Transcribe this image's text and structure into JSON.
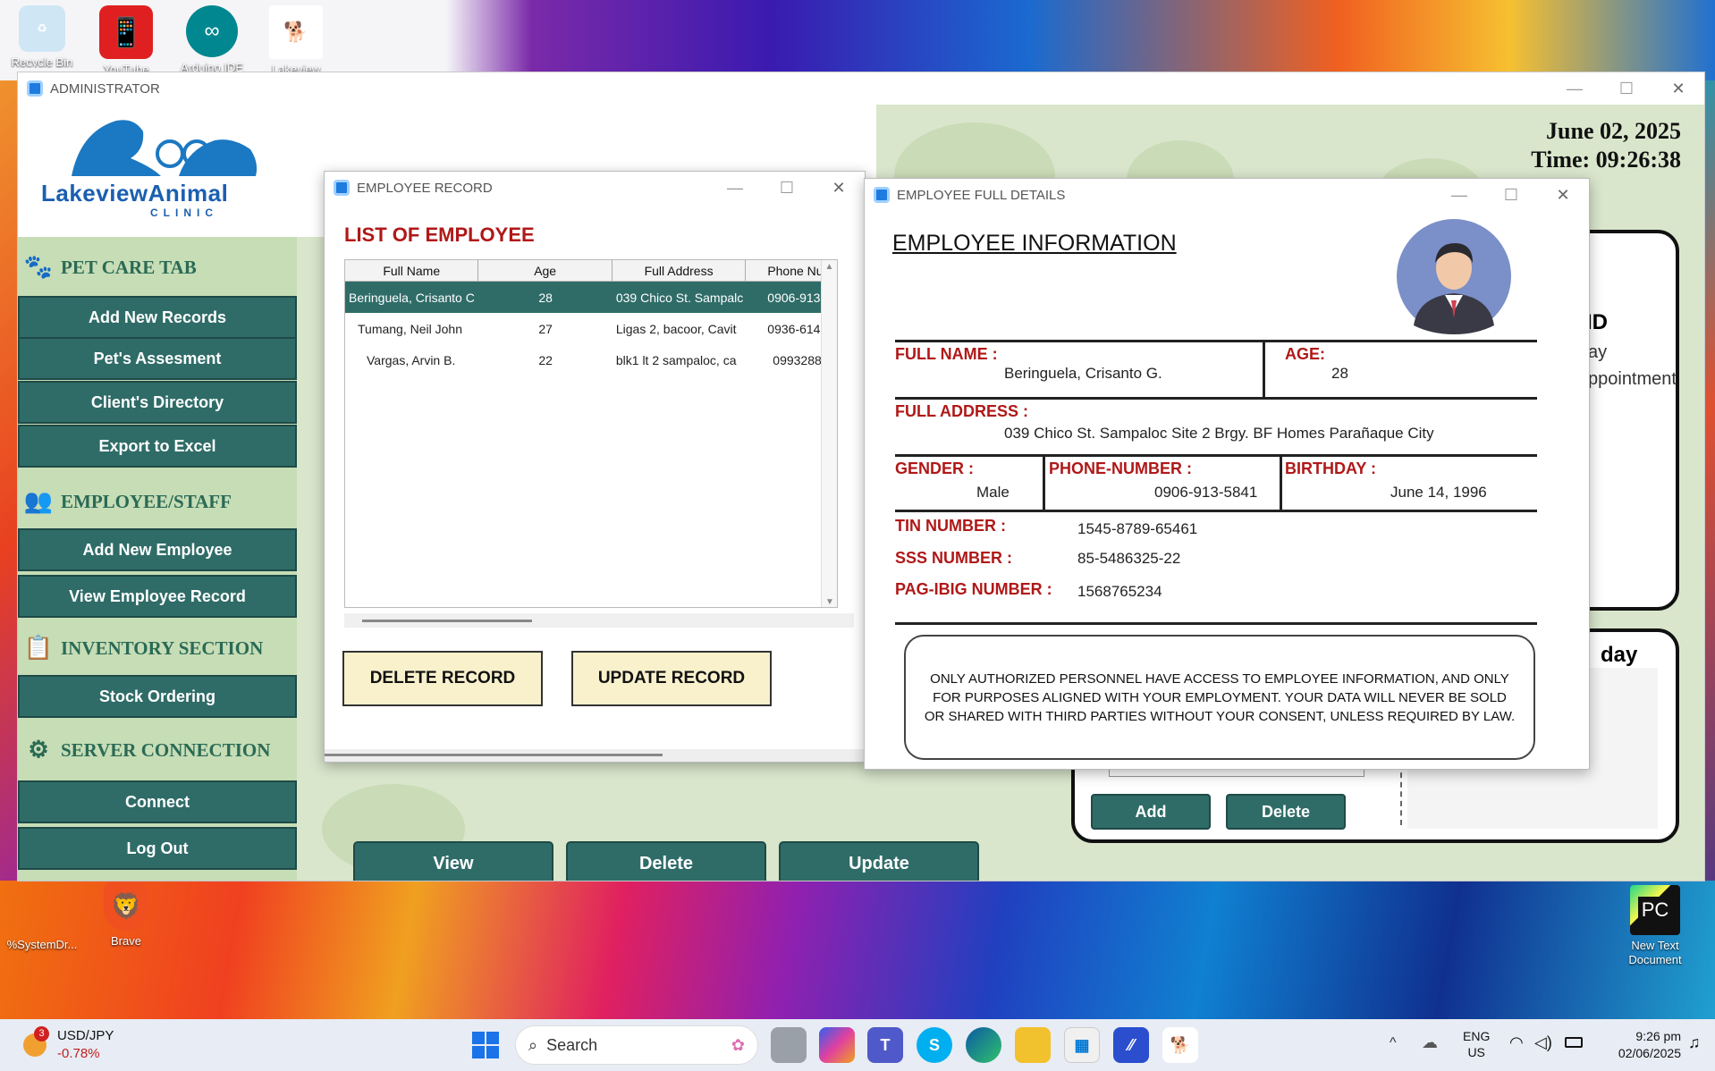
{
  "desktop": {
    "icons": [
      {
        "label": "Recycle Bin",
        "icon": "recycle-bin-icon"
      },
      {
        "label": "YouTube",
        "icon": "phone-icon"
      },
      {
        "label": "Arduino IDE",
        "icon": "arduino-icon"
      },
      {
        "label": "Lakeview",
        "icon": "lakeview-icon"
      },
      {
        "label": "%SystemDr...",
        "icon": "folder-icon"
      },
      {
        "label": "Brave",
        "icon": "brave-icon"
      },
      {
        "label": "New Text Document",
        "icon": "pycharm-icon"
      }
    ]
  },
  "main_window": {
    "title": "ADMINISTRATOR",
    "date": "June 02, 2025",
    "time": "Time:  09:26:38",
    "logo_text": "LakeviewAnimal",
    "logo_sub": "CLINIC",
    "sidebar": {
      "pet_care_title": "PET CARE TAB",
      "pet_care_buttons": [
        "Add New Records",
        "Pet's Assesment",
        "Client's Directory",
        "Export to Excel"
      ],
      "employee_title": "EMPLOYEE/STAFF",
      "employee_buttons": [
        "Add New Employee",
        "View Employee Record"
      ],
      "inventory_title": "INVENTORY SECTION",
      "inventory_buttons": [
        "Stock Ordering"
      ],
      "server_title": "SERVER CONNECTION",
      "server_buttons": [
        "Connect",
        "Log Out"
      ]
    },
    "bottom_buttons": [
      "View",
      "Delete",
      "Update"
    ],
    "right_panel_fragments": [
      "ID",
      "ay",
      "ppointment",
      "day"
    ],
    "right_buttons": [
      "Add",
      "Delete"
    ]
  },
  "record_window": {
    "title": "EMPLOYEE RECORD",
    "heading": "LIST OF EMPLOYEE",
    "columns": [
      "Full Name",
      "Age",
      "Full Address",
      "Phone Nur"
    ],
    "rows": [
      {
        "name": "Beringuela, Crisanto C",
        "age": "28",
        "address": "039 Chico St. Sampalc",
        "phone": "0906-913-"
      },
      {
        "name": "Tumang, Neil John",
        "age": "27",
        "address": "Ligas 2, bacoor, Cavit",
        "phone": "0936-614-"
      },
      {
        "name": "Vargas, Arvin B.",
        "age": "22",
        "address": "blk1 lt 2 sampaloc, ca",
        "phone": "09932882"
      }
    ],
    "delete_button": "DELETE RECORD",
    "update_button": "UPDATE RECORD"
  },
  "details_window": {
    "title": "EMPLOYEE FULL DETAILS",
    "heading": "EMPLOYEE INFORMATION",
    "full_name_label": "FULL NAME :",
    "full_name": "Beringuela, Crisanto G.",
    "age_label": "AGE:",
    "age": "28",
    "address_label": "FULL ADDRESS :",
    "address": "039 Chico St. Sampaloc Site 2 Brgy. BF Homes Parañaque City",
    "gender_label": "GENDER :",
    "gender": "Male",
    "phone_label": "PHONE-NUMBER :",
    "phone": "0906-913-5841",
    "birthday_label": "BIRTHDAY :",
    "birthday": "June 14, 1996",
    "tin_label": "TIN NUMBER :",
    "tin": "1545-8789-65461",
    "sss_label": "SSS NUMBER :",
    "sss": "85-5486325-22",
    "pagibig_label": "PAG-IBIG NUMBER :",
    "pagibig": "1568765234",
    "notice": "ONLY AUTHORIZED PERSONNEL HAVE ACCESS TO EMPLOYEE INFORMATION, AND ONLY FOR PURPOSES ALIGNED WITH YOUR EMPLOYMENT. YOUR DATA WILL NEVER BE SOLD OR SHARED WITH THIRD PARTIES WITHOUT YOUR CONSENT, UNLESS REQUIRED BY LAW."
  },
  "taskbar": {
    "ticker_name": "USD/JPY",
    "ticker_change": "-0.78%",
    "ticker_badge": "3",
    "search_placeholder": "Search",
    "lang_top": "ENG",
    "lang_bottom": "US",
    "clock_time": "9:26 pm",
    "clock_date": "02/06/2025"
  },
  "colors": {
    "sidebar_button": "#2f6c68",
    "heading_red": "#b01818",
    "record_button": "#f9f1cc"
  }
}
